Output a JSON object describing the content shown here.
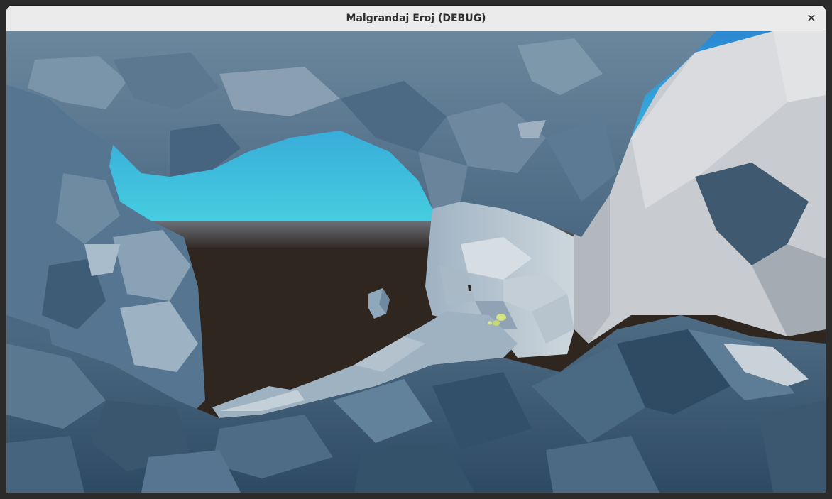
{
  "window": {
    "title": "Malgrandaj Eroj (DEBUG)",
    "close_icon": "close-icon"
  },
  "scene": {
    "colors": {
      "sky_top": "#2f8fd6",
      "sky_bottom": "#45cde0",
      "ground": "#2f2620",
      "rock_dark": "#3e5a72",
      "rock_mid": "#5f7f98",
      "rock_light": "#b9c6d0",
      "wall_light": "#c9ccd0",
      "mushroom": "#cfe07a"
    }
  }
}
